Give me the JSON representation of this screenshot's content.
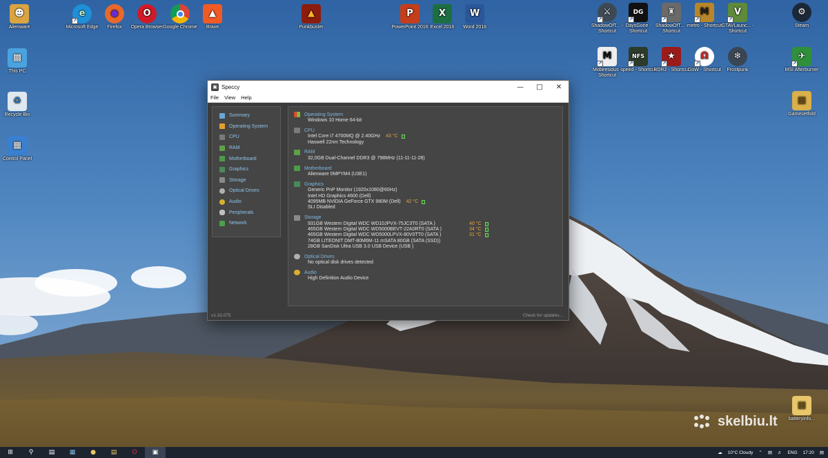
{
  "desktop": {
    "icons_left": [
      {
        "label": "Alienware",
        "icon": "user-folder-icon",
        "color": "#d9a441"
      },
      {
        "label": "Microsoft Edge",
        "icon": "edge-icon",
        "color": "#1f8fd6"
      },
      {
        "label": "Firefox",
        "icon": "firefox-icon",
        "color": "#e8692b"
      },
      {
        "label": "Opera Browser",
        "icon": "opera-icon",
        "color": "#d11a28"
      },
      {
        "label": "Google Chrome",
        "icon": "chrome-icon",
        "color": "#e8c12b"
      },
      {
        "label": "Brave",
        "icon": "brave-icon",
        "color": "#f15a24"
      },
      {
        "label": "Punkbuster",
        "icon": "punkbuster-icon",
        "color": "#8c1c0c"
      },
      {
        "label": "PowerPoint 2016",
        "icon": "powerpoint-icon",
        "color": "#c43e1c"
      },
      {
        "label": "Excel 2016",
        "icon": "excel-icon",
        "color": "#1d6f42"
      },
      {
        "label": "Word 2016",
        "icon": "word-icon",
        "color": "#2b579a"
      }
    ],
    "icons_column": [
      {
        "label": "This PC",
        "icon": "computer-icon",
        "color": "#4aa3df"
      },
      {
        "label": "Recycle Bin",
        "icon": "recycle-bin-icon",
        "color": "#dfe8ef"
      },
      {
        "label": "Control Panel",
        "icon": "control-panel-icon",
        "color": "#3a7fd0"
      }
    ],
    "icons_right_row1": [
      {
        "label": "ShadowOfT... - Shortcut",
        "icon": "shadow-game-icon",
        "color": "#3d4a55"
      },
      {
        "label": "DaysGone - Shortcut",
        "icon": "days-gone-icon",
        "color": "#111111"
      },
      {
        "label": "ShadowOfT... - Shortcut",
        "icon": "transformers-icon",
        "color": "#6a6a6a"
      },
      {
        "label": "metro - Shortcut",
        "icon": "metro-icon",
        "color": "#b8862a"
      },
      {
        "label": "GTAVLaunc... - Shortcut",
        "icon": "gta-icon",
        "color": "#5e8a3a"
      },
      {
        "label": "Steam",
        "icon": "steam-icon",
        "color": "#1b2838"
      }
    ],
    "icons_right_row2": [
      {
        "label": "Mobiresidus - Shortcut",
        "icon": "mobi-icon",
        "color": "#eeeeee"
      },
      {
        "label": "speed - Shortcut",
        "icon": "nfs-icon",
        "color": "#2c3b2a"
      },
      {
        "label": "RDR2 - Shortcut",
        "icon": "rdr2-icon",
        "color": "#9b1b1b"
      },
      {
        "label": "GoW - Shortcut",
        "icon": "gow-icon",
        "color": "#cc2222"
      },
      {
        "label": "Frostpunk",
        "icon": "frostpunk-icon",
        "color": "#3a4654"
      },
      {
        "label": "MSI Afterburner",
        "icon": "msi-icon",
        "color": "#2f8f3a"
      }
    ],
    "icons_right_column": [
      {
        "label": "Gamesetfold",
        "icon": "folder-icon",
        "color": "#d9b04a"
      },
      {
        "label": "batteryinfo...",
        "icon": "folder-icon",
        "color": "#e8c66a"
      }
    ],
    "watermark": "skelbiu.lt"
  },
  "window": {
    "title": "Speccy",
    "menu": [
      "File",
      "View",
      "Help"
    ],
    "controls": {
      "minimize": "—",
      "maximize": "□",
      "close": "✕"
    },
    "nav": [
      {
        "label": "Summary",
        "color": "#6aa6d8"
      },
      {
        "label": "Operating System",
        "color": "#e0a030"
      },
      {
        "label": "CPU",
        "color": "#7a7a7a"
      },
      {
        "label": "RAM",
        "color": "#5fa04a"
      },
      {
        "label": "Motherboard",
        "color": "#4f9a4a"
      },
      {
        "label": "Graphics",
        "color": "#4a8a5a"
      },
      {
        "label": "Storage",
        "color": "#8a8a8a"
      },
      {
        "label": "Optical Drives",
        "color": "#b0b0b0"
      },
      {
        "label": "Audio",
        "color": "#d8b030"
      },
      {
        "label": "Peripherals",
        "color": "#c0c0c0"
      },
      {
        "label": "Network",
        "color": "#4aa04a"
      }
    ],
    "summary": {
      "os": {
        "title": "Operating System",
        "lines": [
          "Windows 10 Home 64-bit"
        ]
      },
      "cpu": {
        "title": "CPU",
        "lines": [
          "Intel Core i7 4700MQ @ 2.40GHz",
          "Haswell 22nm Technology"
        ],
        "temp": "43 °C"
      },
      "ram": {
        "title": "RAM",
        "lines": [
          "32,0GB Dual-Channel DDR3 @ 798MHz (11-11-11-28)"
        ]
      },
      "motherboard": {
        "title": "Motherboard",
        "lines": [
          "Alienware 0MPYM4 (U3E1)"
        ]
      },
      "graphics": {
        "title": "Graphics",
        "lines": [
          "Generic PnP Monitor (1920x1080@60Hz)",
          "Intel HD Graphics 4600 (Dell)",
          "4095MB NVIDIA GeForce GTX 980M (Dell)",
          "SLI Disabled"
        ],
        "temp": "42 °C"
      },
      "storage": {
        "title": "Storage",
        "rows": [
          {
            "text": "931GB Western Digital WDC WD10JPVX-75JC3T0 (SATA )",
            "temp": "40 °C"
          },
          {
            "text": "465GB Western Digital WDC WD5000BEVT-22A0RT0 (SATA )",
            "temp": "34 °C"
          },
          {
            "text": "465GB Western Digital WDC WD5000LPVX-80V0TT0 (SATA )",
            "temp": "31 °C"
          },
          {
            "text": "74GB LITEONIT DMT-80M6M-11 mSATA 80GB (SATA (SSD))",
            "temp": ""
          },
          {
            "text": "28GB SanDisk Ultra USB 3.0 USB Device (USB )",
            "temp": ""
          }
        ]
      },
      "optical": {
        "title": "Optical Drives",
        "lines": [
          "No optical disk drives detected"
        ]
      },
      "audio": {
        "title": "Audio",
        "lines": [
          "High Definition Audio Device"
        ]
      }
    },
    "status": {
      "version": "v1.33.075",
      "update": "Check for updates..."
    }
  },
  "taskbar": {
    "weather": "10°C  Cloudy",
    "lang": "ENG",
    "time": "17:20"
  }
}
